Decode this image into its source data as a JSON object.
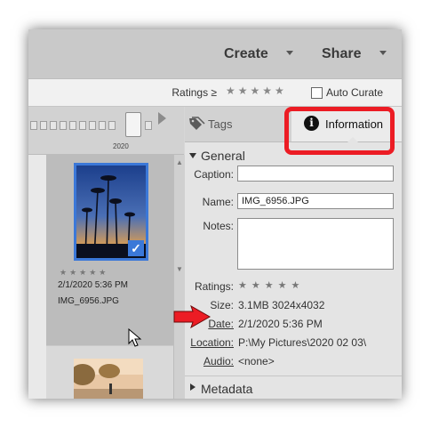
{
  "topbar": {
    "create_label": "Create",
    "share_label": "Share"
  },
  "filter_bar": {
    "ratings_label": "Ratings ≥",
    "stars": "★★★★★",
    "auto_curate_label": "Auto Curate",
    "auto_curate_checked": false
  },
  "timeline": {
    "year": "2020"
  },
  "grid": {
    "selected_item": {
      "stars": "★★★★★",
      "date": "2/1/2020 5:36 PM",
      "filename": "IMG_6956.JPG",
      "checked": true
    }
  },
  "tabs": {
    "tags_label": "Tags",
    "information_label": "Information"
  },
  "general": {
    "title": "General",
    "caption_label": "Caption:",
    "caption_value": "",
    "name_label": "Name:",
    "name_value": "IMG_6956.JPG",
    "notes_label": "Notes:",
    "notes_value": "",
    "ratings_label": "Ratings:",
    "ratings_stars": "★★★★★",
    "size_label": "Size:",
    "size_value": "3.1MB  3024x4032",
    "date_label": "Date:",
    "date_value": "2/1/2020 5:36 PM",
    "location_label": "Location:",
    "location_value": "P:\\My Pictures\\2020 02 03\\",
    "audio_label": "Audio:",
    "audio_value": "<none>"
  },
  "metadata": {
    "title": "Metadata"
  },
  "colors": {
    "highlight": "#ec1c24",
    "selection": "#3b78d8"
  }
}
